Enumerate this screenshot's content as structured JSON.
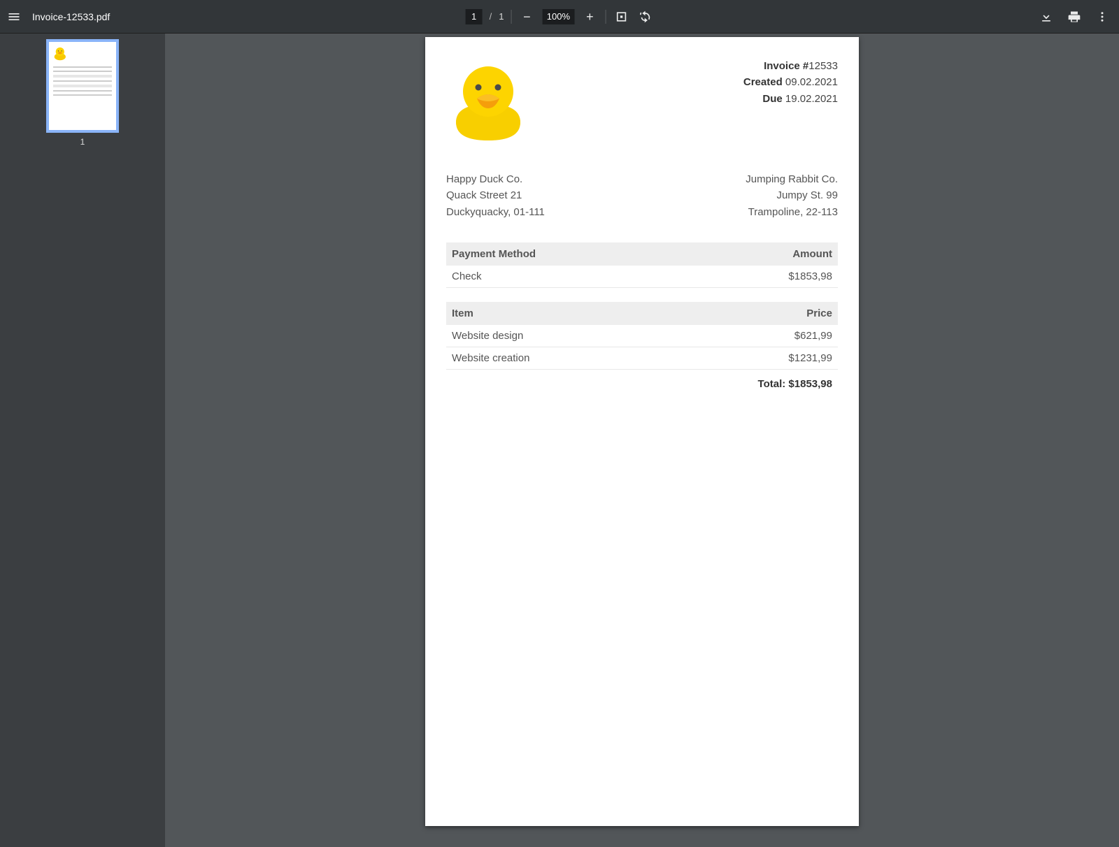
{
  "toolbar": {
    "filename": "Invoice-12533.pdf",
    "current_page": "1",
    "page_sep": "/",
    "total_pages": "1",
    "zoom": "100%"
  },
  "sidebar": {
    "thumb_label": "1"
  },
  "invoice": {
    "meta": {
      "invoice_label": "Invoice #",
      "invoice_no": "12533",
      "created_label": "Created",
      "created_date": "09.02.2021",
      "due_label": "Due",
      "due_date": "19.02.2021"
    },
    "from": {
      "name": "Happy Duck Co.",
      "street": "Quack Street 21",
      "city": "Duckyquacky, 01-111"
    },
    "to": {
      "name": "Jumping Rabbit Co.",
      "street": "Jumpy St. 99",
      "city": "Trampoline, 22-113"
    },
    "payment_table": {
      "h1": "Payment Method",
      "h2": "Amount",
      "row_method": "Check",
      "row_amount": "$1853,98"
    },
    "items_table": {
      "h1": "Item",
      "h2": "Price",
      "rows": [
        {
          "item": "Website design",
          "price": "$621,99"
        },
        {
          "item": "Website creation",
          "price": "$1231,99"
        }
      ]
    },
    "total_label": "Total:",
    "total_value": "$1853,98"
  }
}
